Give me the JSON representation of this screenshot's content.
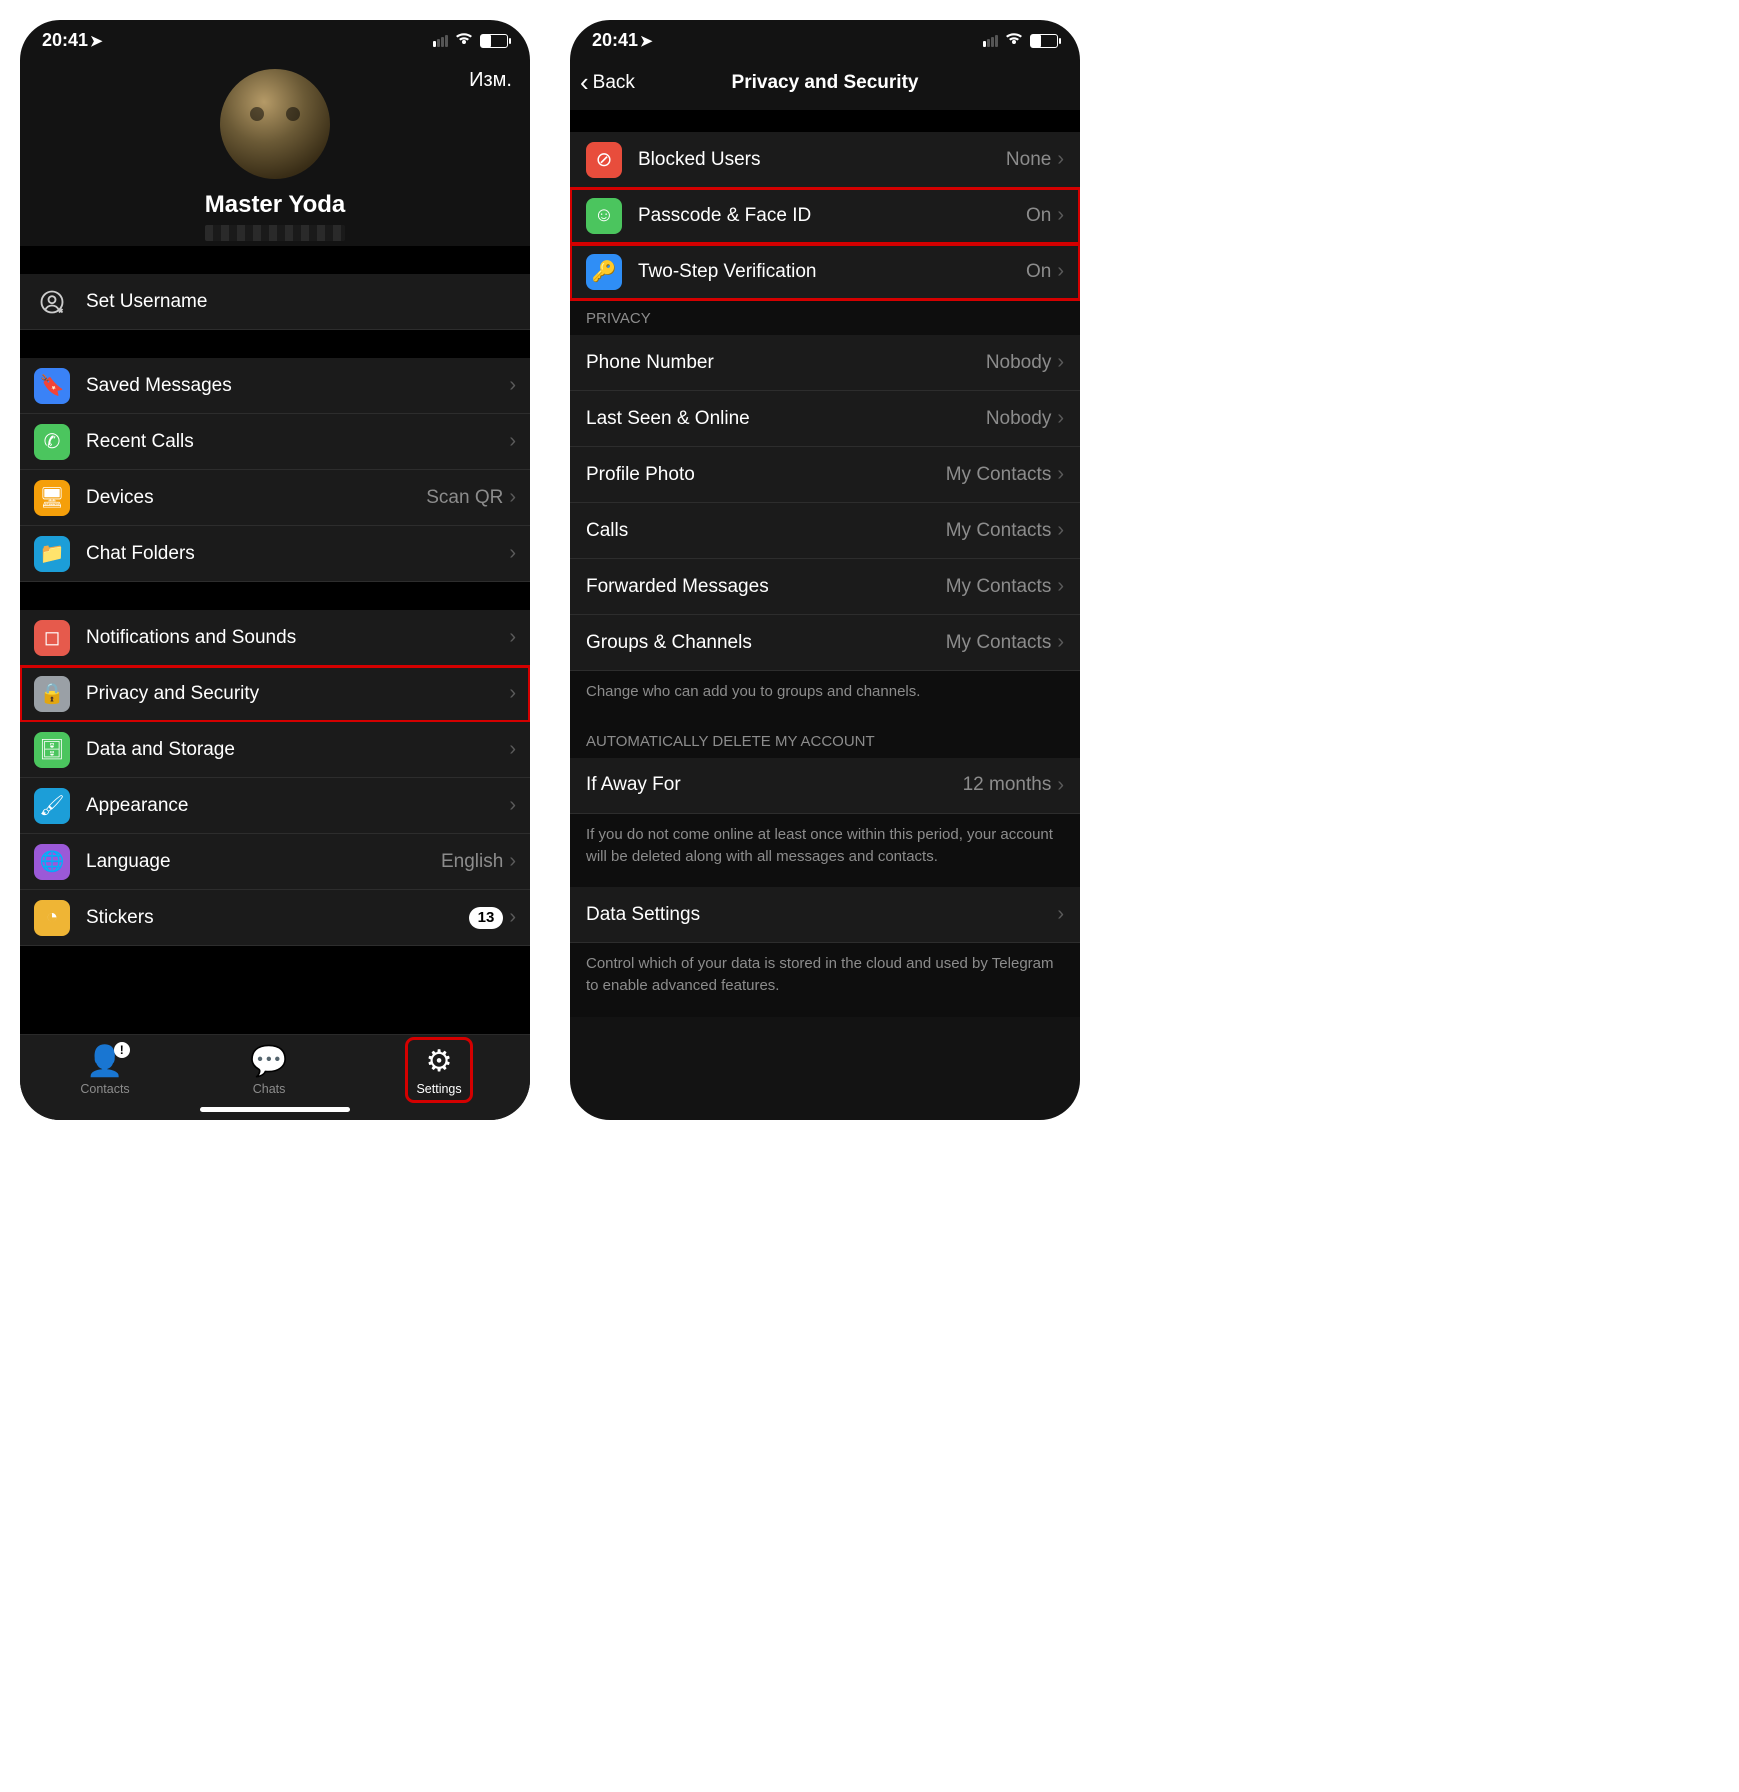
{
  "status": {
    "time": "20:41"
  },
  "screen1": {
    "edit": "Изм.",
    "profile_name": "Master Yoda",
    "set_username": {
      "label": "Set Username"
    },
    "saved_messages": {
      "label": "Saved Messages"
    },
    "recent_calls": {
      "label": "Recent Calls"
    },
    "devices": {
      "label": "Devices",
      "value": "Scan QR"
    },
    "chat_folders": {
      "label": "Chat Folders"
    },
    "notifications": {
      "label": "Notifications and Sounds"
    },
    "privacy": {
      "label": "Privacy and Security"
    },
    "data_storage": {
      "label": "Data and Storage"
    },
    "appearance": {
      "label": "Appearance"
    },
    "language": {
      "label": "Language",
      "value": "English"
    },
    "stickers": {
      "label": "Stickers",
      "badge": "13"
    },
    "tabs": {
      "contacts": "Contacts",
      "chats": "Chats",
      "settings": "Settings"
    }
  },
  "screen2": {
    "back": "Back",
    "title": "Privacy and Security",
    "blocked": {
      "label": "Blocked Users",
      "value": "None"
    },
    "passcode": {
      "label": "Passcode & Face ID",
      "value": "On"
    },
    "twostep": {
      "label": "Two-Step Verification",
      "value": "On"
    },
    "section_privacy": "PRIVACY",
    "phone": {
      "label": "Phone Number",
      "value": "Nobody"
    },
    "lastseen": {
      "label": "Last Seen & Online",
      "value": "Nobody"
    },
    "photo": {
      "label": "Profile Photo",
      "value": "My Contacts"
    },
    "calls": {
      "label": "Calls",
      "value": "My Contacts"
    },
    "forwarded": {
      "label": "Forwarded Messages",
      "value": "My Contacts"
    },
    "groups": {
      "label": "Groups & Channels",
      "value": "My Contacts"
    },
    "footer_privacy": "Change who can add you to groups and channels.",
    "section_auto": "AUTOMATICALLY DELETE MY ACCOUNT",
    "away": {
      "label": "If Away For",
      "value": "12 months"
    },
    "footer_auto": "If you do not come online at least once within this period, your account will be deleted along with all messages and contacts.",
    "data_settings": {
      "label": "Data Settings"
    },
    "footer_data": "Control which of your data is stored in the cloud and used by Telegram to enable advanced features."
  }
}
